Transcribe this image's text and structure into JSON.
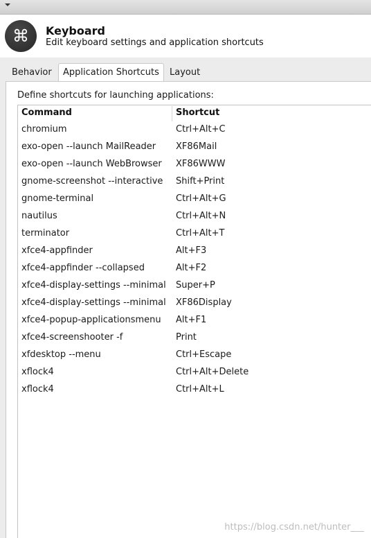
{
  "header": {
    "icon": "keyboard-command-icon",
    "title": "Keyboard",
    "subtitle": "Edit keyboard settings and application shortcuts"
  },
  "tabs": [
    {
      "label": "Behavior",
      "active": false
    },
    {
      "label": "Application Shortcuts",
      "active": true
    },
    {
      "label": "Layout",
      "active": false
    }
  ],
  "pane": {
    "description": "Define shortcuts for launching applications:"
  },
  "table": {
    "columns": [
      "Command",
      "Shortcut"
    ],
    "rows": [
      {
        "command": "chromium",
        "shortcut": "Ctrl+Alt+C"
      },
      {
        "command": "exo-open --launch MailReader",
        "shortcut": "XF86Mail"
      },
      {
        "command": "exo-open --launch WebBrowser",
        "shortcut": "XF86WWW"
      },
      {
        "command": "gnome-screenshot --interactive",
        "shortcut": "Shift+Print"
      },
      {
        "command": "gnome-terminal",
        "shortcut": "Ctrl+Alt+G"
      },
      {
        "command": "nautilus",
        "shortcut": "Ctrl+Alt+N"
      },
      {
        "command": "terminator",
        "shortcut": "Ctrl+Alt+T"
      },
      {
        "command": "xfce4-appfinder",
        "shortcut": "Alt+F3"
      },
      {
        "command": "xfce4-appfinder --collapsed",
        "shortcut": "Alt+F2"
      },
      {
        "command": "xfce4-display-settings --minimal",
        "shortcut": "Super+P"
      },
      {
        "command": "xfce4-display-settings --minimal",
        "shortcut": "XF86Display"
      },
      {
        "command": "xfce4-popup-applicationsmenu",
        "shortcut": "Alt+F1"
      },
      {
        "command": "xfce4-screenshooter -f",
        "shortcut": "Print"
      },
      {
        "command": "xfdesktop --menu",
        "shortcut": "Ctrl+Escape"
      },
      {
        "command": "xflock4",
        "shortcut": "Ctrl+Alt+Delete"
      },
      {
        "command": "xflock4",
        "shortcut": "Ctrl+Alt+L"
      }
    ]
  },
  "watermark": "https://blog.csdn.net/hunter___"
}
